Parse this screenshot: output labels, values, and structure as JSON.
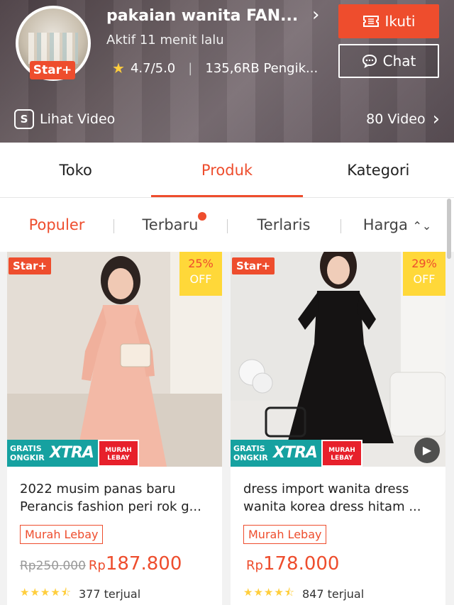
{
  "shop": {
    "name": "pakaian wanita FAN...",
    "badge": "Star+",
    "active": "Aktif 11 menit lalu",
    "rating": "4.7/5.0",
    "followers": "135,6RB Pengik...",
    "follow_label": "Ikuti",
    "chat_label": "Chat"
  },
  "video": {
    "left_label": "Lihat Video",
    "right_label": "80 Video"
  },
  "tabs": [
    {
      "label": "Toko"
    },
    {
      "label": "Produk"
    },
    {
      "label": "Kategori"
    }
  ],
  "filters": [
    {
      "label": "Populer"
    },
    {
      "label": "Terbaru"
    },
    {
      "label": "Terlaris"
    },
    {
      "label": "Harga"
    }
  ],
  "products": [
    {
      "badge": "Star+",
      "discount": "25%",
      "discount_off": "OFF",
      "promo_gratis": "GRATIS ONGKIR",
      "promo_xtra": "XTRA",
      "promo_murah": "MURAH LEBAY",
      "title": "2022 musim panas baru Perancis fashion peri rok g...",
      "tag": "Murah Lebay",
      "price_orig": "Rp250.000",
      "price_currency": "Rp",
      "price": "187.800",
      "sold": "377 terjual",
      "rating": 4.5
    },
    {
      "badge": "Star+",
      "discount": "29%",
      "discount_off": "OFF",
      "promo_gratis": "GRATIS ONGKIR",
      "promo_xtra": "XTRA",
      "promo_murah": "MURAH LEBAY",
      "title": "dress import wanita dress wanita korea dress hitam ...",
      "tag": "Murah Lebay",
      "price_orig": "",
      "price_currency": "Rp",
      "price": "178.000",
      "sold": "847 terjual",
      "rating": 4.5
    }
  ],
  "colors": {
    "accent": "#ee4d2d",
    "promo_teal": "#16a1a0",
    "discount_yellow": "#ffd839"
  }
}
